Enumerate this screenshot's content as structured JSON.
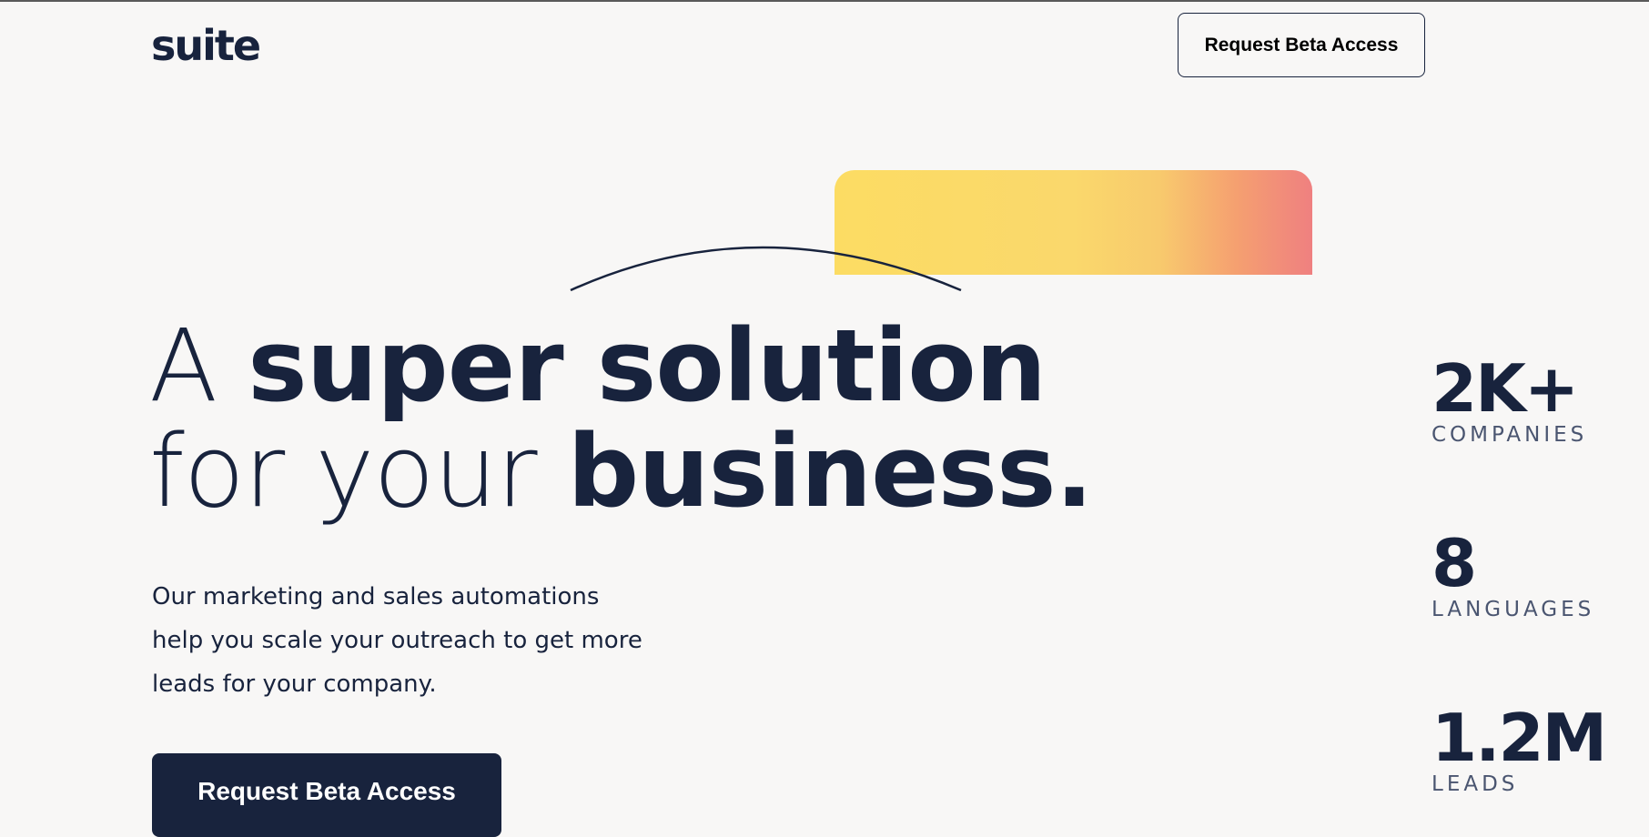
{
  "header": {
    "logo": "suite",
    "nav_button_label": "Request Beta Access"
  },
  "hero": {
    "headline_line1_light": "A ",
    "headline_line1_bold": "super solution",
    "headline_line2_light": "for your ",
    "headline_line2_bold": "business.",
    "description": "Our marketing and sales automations help you scale your outreach to get more leads for your company.",
    "cta_label": "Request Beta Access"
  },
  "stats": [
    {
      "value": "2K+",
      "label": "COMPANIES"
    },
    {
      "value": "8",
      "label": "LANGUAGES"
    },
    {
      "value": "1.2M",
      "label": "LEADS"
    }
  ],
  "colors": {
    "background": "#f8f7f6",
    "primary": "#18233d",
    "gradient_start": "#fcdc63",
    "gradient_end": "#ef8080"
  }
}
